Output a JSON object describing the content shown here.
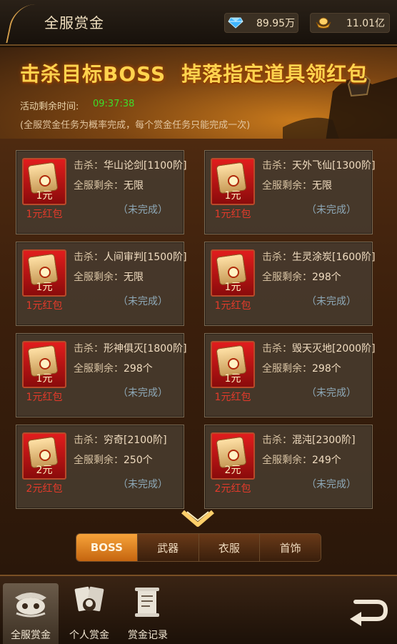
{
  "header": {
    "title": "全服赏金",
    "diamond_amount": "89.95万",
    "gold_amount": "11.01亿",
    "diamond_icon": "diamond-icon",
    "gold_icon": "gold-ingot-icon"
  },
  "banner": {
    "headline_part1": "击杀目标BOSS",
    "headline_part2": "掉落指定道具领红包",
    "timer_label": "活动剩余时间:",
    "timer_value": "09:37:38",
    "note": "(全服赏金任务为概率完成，每个赏金任务只能完成一次)"
  },
  "card_labels": {
    "target_prefix": "击杀：",
    "remain_prefix": "全服剩余："
  },
  "cards": [
    {
      "target": "华山论剑[1100阶]",
      "remain": "无限",
      "amount": "1元",
      "reward": "1元红包",
      "status": "（未完成）"
    },
    {
      "target": "天外飞仙[1300阶]",
      "remain": "无限",
      "amount": "1元",
      "reward": "1元红包",
      "status": "（未完成）"
    },
    {
      "target": "人间审判[1500阶]",
      "remain": "无限",
      "amount": "1元",
      "reward": "1元红包",
      "status": "（未完成）"
    },
    {
      "target": "生灵涂炭[1600阶]",
      "remain": "298个",
      "amount": "1元",
      "reward": "1元红包",
      "status": "（未完成）"
    },
    {
      "target": "形神俱灭[1800阶]",
      "remain": "298个",
      "amount": "1元",
      "reward": "1元红包",
      "status": "（未完成）"
    },
    {
      "target": "毁天灭地[2000阶]",
      "remain": "298个",
      "amount": "1元",
      "reward": "1元红包",
      "status": "（未完成）"
    },
    {
      "target": "穷奇[2100阶]",
      "remain": "250个",
      "amount": "2元",
      "reward": "2元红包",
      "status": "（未完成）"
    },
    {
      "target": "混沌[2300阶]",
      "remain": "249个",
      "amount": "2元",
      "reward": "2元红包",
      "status": "（未完成）"
    }
  ],
  "tabs": [
    {
      "label": "BOSS",
      "active": true
    },
    {
      "label": "武器",
      "active": false
    },
    {
      "label": "衣服",
      "active": false
    },
    {
      "label": "首饰",
      "active": false
    }
  ],
  "bottom_nav": [
    {
      "label": "全服赏金",
      "icon": "bounty-mask-icon",
      "active": true
    },
    {
      "label": "个人赏金",
      "icon": "cards-icon",
      "active": false
    },
    {
      "label": "赏金记录",
      "icon": "scroll-icon",
      "active": false
    }
  ],
  "colors": {
    "accent_gold": "#ffd34e",
    "timer_green": "#3dde2a",
    "reward_red": "#e43a2a",
    "active_tab": "#f7a33a"
  }
}
